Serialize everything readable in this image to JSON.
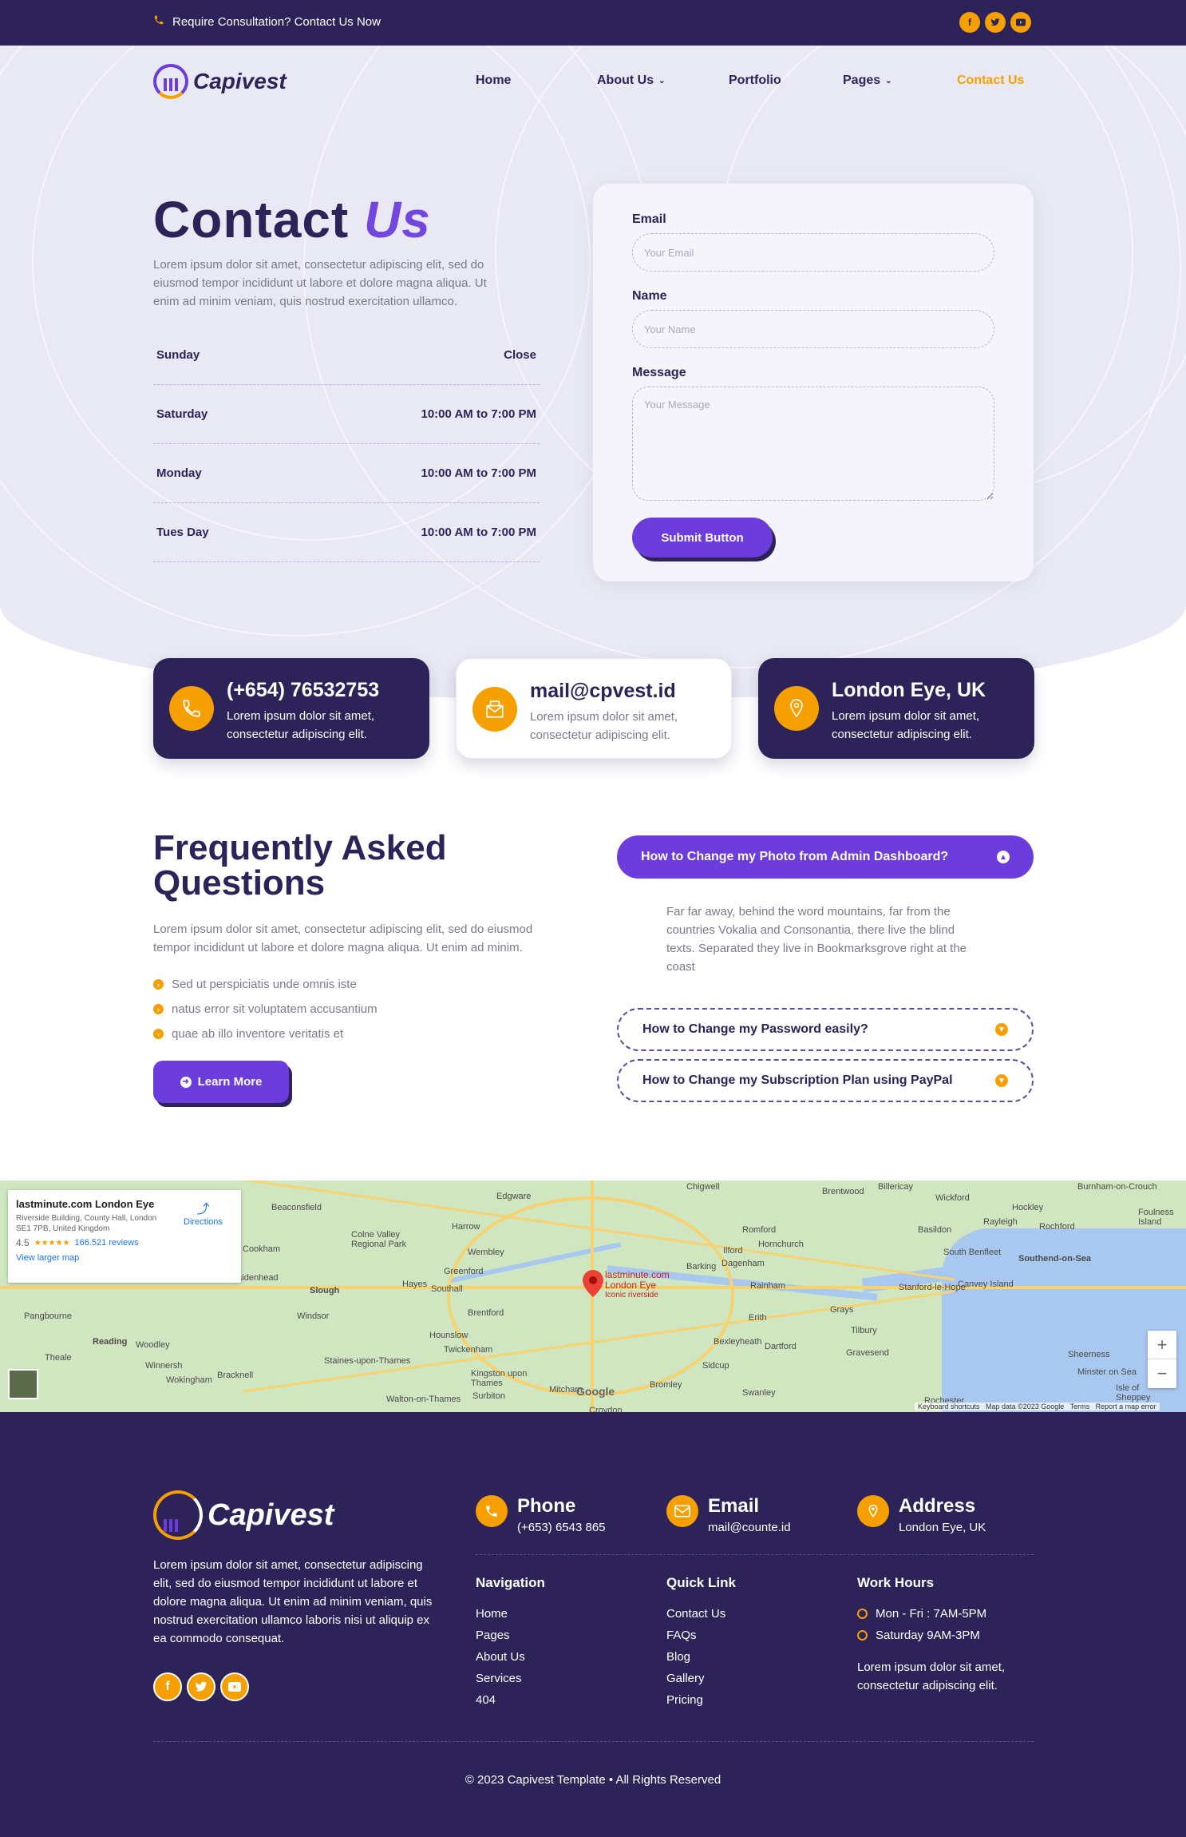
{
  "topbar": {
    "consult_text": "Require Consultation? Contact Us Now",
    "social": [
      "facebook-icon",
      "twitter-icon",
      "youtube-icon"
    ]
  },
  "brand": {
    "name": "Capivest"
  },
  "nav": {
    "items": [
      "Home",
      "About Us",
      "Portfolio",
      "Pages",
      "Contact Us"
    ],
    "active": "Contact Us"
  },
  "hero": {
    "title_main": "Contact",
    "title_accent": "Us",
    "description": "Lorem ipsum dolor sit amet, consectetur adipiscing elit, sed do eiusmod tempor incididunt ut labore et dolore magna aliqua. Ut enim ad minim veniam, quis nostrud exercitation ullamco."
  },
  "hours": [
    {
      "day": "Sunday",
      "time": "Close"
    },
    {
      "day": "Saturday",
      "time": "10:00 AM to 7:00 PM"
    },
    {
      "day": "Monday",
      "time": "10:00 AM to 7:00 PM"
    },
    {
      "day": "Tues Day",
      "time": "10:00 AM to 7:00 PM"
    }
  ],
  "form": {
    "email_label": "Email",
    "email_placeholder": "Your Email",
    "name_label": "Name",
    "name_placeholder": "Your Name",
    "message_label": "Message",
    "message_placeholder": "Your Message",
    "submit_label": "Submit Button"
  },
  "cards": [
    {
      "title": "(+654) 76532753",
      "text": "Lorem ipsum dolor sit amet, consectetur adipiscing elit.",
      "icon": "phone-icon"
    },
    {
      "title": "mail@cpvest.id",
      "text": "Lorem ipsum dolor sit amet, consectetur adipiscing elit.",
      "icon": "mail-icon"
    },
    {
      "title": "London Eye, UK",
      "text": "Lorem ipsum dolor sit amet, consectetur adipiscing elit.",
      "icon": "location-icon"
    }
  ],
  "faq": {
    "title": "Frequently Asked Questions",
    "description": "Lorem ipsum dolor sit amet, consectetur adipiscing elit, sed do eiusmod tempor incididunt ut labore et dolore magna aliqua. Ut enim ad minim.",
    "bullets": [
      "Sed ut perspiciatis unde omnis iste",
      "natus error sit voluptatem accusantium",
      "quae ab illo inventore veritatis et"
    ],
    "learn_more": "Learn More",
    "items": [
      {
        "question": "How to Change my Photo from Admin Dashboard?",
        "answer": "Far far away, behind the word mountains, far from the countries Vokalia and Consonantia, there live the blind texts. Separated they live in Bookmarksgrove right at the coast"
      },
      {
        "question": "How to Change my Password easily?"
      },
      {
        "question": "How to Change my Subscription Plan using PayPal"
      }
    ]
  },
  "map": {
    "place_title": "lastminute.com London Eye",
    "address": "Riverside Building, County Hall, London SE1 7PB, United Kingdom",
    "rating": "4.5",
    "stars": "★★★★★",
    "reviews": "166.521 reviews",
    "directions": "Directions",
    "larger_map": "View larger map",
    "pin_label": "lastminute.com London Eye",
    "pin_sub": "Iconic riverside",
    "places": [
      "Wickford",
      "Billericay",
      "Burnham-on-Crouch",
      "Hockley",
      "Rayleigh",
      "Rochford",
      "Foulness Island",
      "Southend-on-Sea",
      "South Benfleet",
      "Basildon",
      "Canvey Island",
      "Brentwood",
      "Chigwell",
      "Edgware",
      "Harrow",
      "Beaconsfield",
      "Colne Valley Regional Park",
      "Wembley",
      "Romford",
      "Hornchurch",
      "Ilford",
      "Barking",
      "Dagenham",
      "Rainham",
      "Stanford-le-Hope",
      "Grays",
      "Tilbury",
      "Gravesend",
      "Dartford",
      "Bexleyheath",
      "Erith",
      "Sidcup",
      "Bromley",
      "Swanley",
      "Sheerness",
      "Minster on Sea",
      "Isle of Sheppey",
      "Rochester",
      "Croydon",
      "Mitcham",
      "Kingston upon Thames",
      "Surbiton",
      "Twickenham",
      "Hounslow",
      "Brentford",
      "Southall",
      "Hayes",
      "Greenford",
      "Slough",
      "Windsor",
      "Maidenhead",
      "Cookham",
      "Reading",
      "Woodley",
      "Wokingham",
      "Bracknell",
      "Winnersh",
      "Theale",
      "Pangbourne",
      "Staines-upon-Thames",
      "Walton-on-Thames"
    ],
    "attribution": "Keyboard shortcuts   Map data ©2023 Google   Terms   Report a map error",
    "google": "Google"
  },
  "footer": {
    "brand": "Capivest",
    "about": "Lorem ipsum dolor sit amet, consectetur adipiscing elit, sed do eiusmod tempor incididunt ut labore et dolore magna aliqua. Ut enim ad minim veniam, quis nostrud exercitation ullamco laboris nisi ut aliquip ex ea commodo consequat.",
    "contacts": [
      {
        "title": "Phone",
        "value": "(+653) 6543 865",
        "icon": "phone-icon"
      },
      {
        "title": "Email",
        "value": "mail@counte.id",
        "icon": "mail-icon"
      },
      {
        "title": "Address",
        "value": "London Eye, UK",
        "icon": "location-icon"
      }
    ],
    "navigation": {
      "title": "Navigation",
      "links": [
        "Home",
        "Pages",
        "About Us",
        "Services",
        "404"
      ]
    },
    "quick_link": {
      "title": "Quick Link",
      "links": [
        "Contact Us",
        "FAQs",
        "Blog",
        "Gallery",
        "Pricing"
      ]
    },
    "work_hours": {
      "title": "Work Hours",
      "lines": [
        "Mon - Fri : 7AM-5PM",
        "Saturday 9AM-3PM"
      ],
      "text": "Lorem ipsum dolor sit amet, consectetur adipiscing elit."
    },
    "copyright": "© 2023 Capivest Template • All Rights Reserved"
  },
  "colors": {
    "primary": "#2e2359",
    "accent": "#6c3cdc",
    "orange": "#f5a000",
    "hero_bg": "#e8e9f4"
  }
}
